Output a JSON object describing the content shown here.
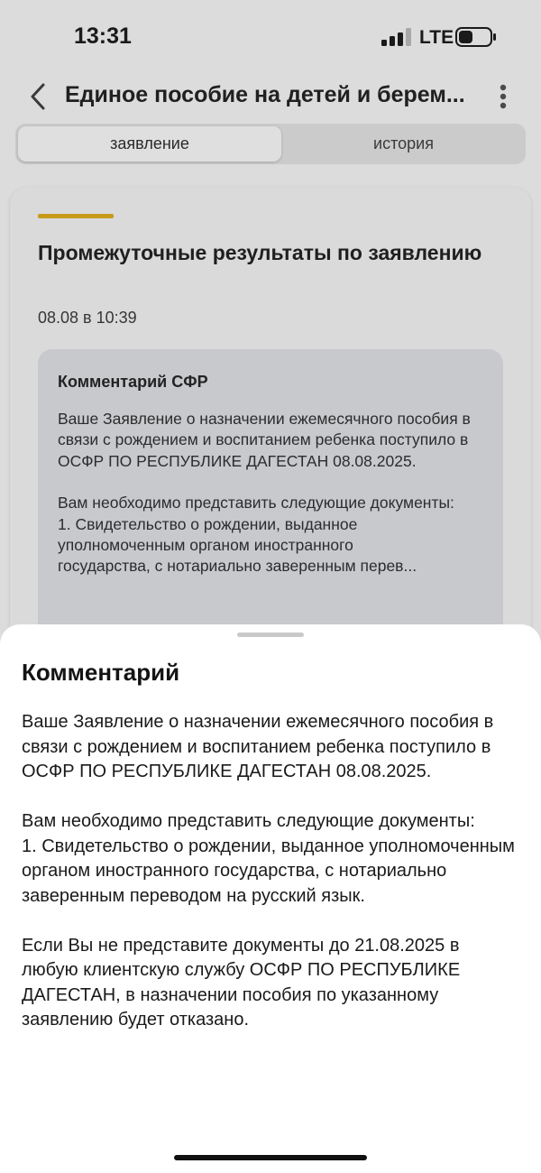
{
  "status_bar": {
    "time": "13:31",
    "network": "LTE",
    "signal_icon": "signal-bars-icon",
    "battery_icon": "battery-icon"
  },
  "header": {
    "back_icon": "chevron-left-icon",
    "title": "Единое пособие на детей и берем...",
    "more_icon": "more-vertical-icon"
  },
  "tabs": [
    {
      "label": "заявление",
      "active": true
    },
    {
      "label": "история",
      "active": false
    }
  ],
  "card": {
    "accent_color": "#c89a1c",
    "title": "Промежуточные результаты по заявлению",
    "date": "08.08 в 10:39",
    "comment": {
      "title": "Комментарий СФР",
      "paragraph1": "Ваше Заявление о назначении ежемесячного пособия в связи с рождением и воспитанием ребенка поступило в ОСФР ПО РЕСПУБЛИКЕ ДАГЕСТАН 08.08.2025.",
      "paragraph2_line1": "Вам необходимо представить следующие документы:",
      "paragraph2_line2": "1. Свидетельство о рождении, выданное уполномоченным органом иностранного",
      "paragraph2_truncated": "государства, с нотариально заверенным перев..."
    }
  },
  "sheet": {
    "title": "Комментарий",
    "paragraph1": "Ваше Заявление о назначении ежемесячного пособия в связи с рождением и воспитанием ребенка поступило в ОСФР ПО РЕСПУБЛИКЕ ДАГЕСТАН 08.08.2025.",
    "paragraph2_line1": "Вам необходимо представить следующие документы:",
    "paragraph2_line2": "1. Свидетельство о рождении, выданное уполномоченным органом иностранного государства, с нотариально заверенным переводом на русский язык.",
    "paragraph3": "Если Вы не представите документы до 21.08.2025 в любую клиентскую службу ОСФР ПО РЕСПУБЛИКЕ ДАГЕСТАН, в назначении пособия по указанному заявлению будет отказано."
  }
}
